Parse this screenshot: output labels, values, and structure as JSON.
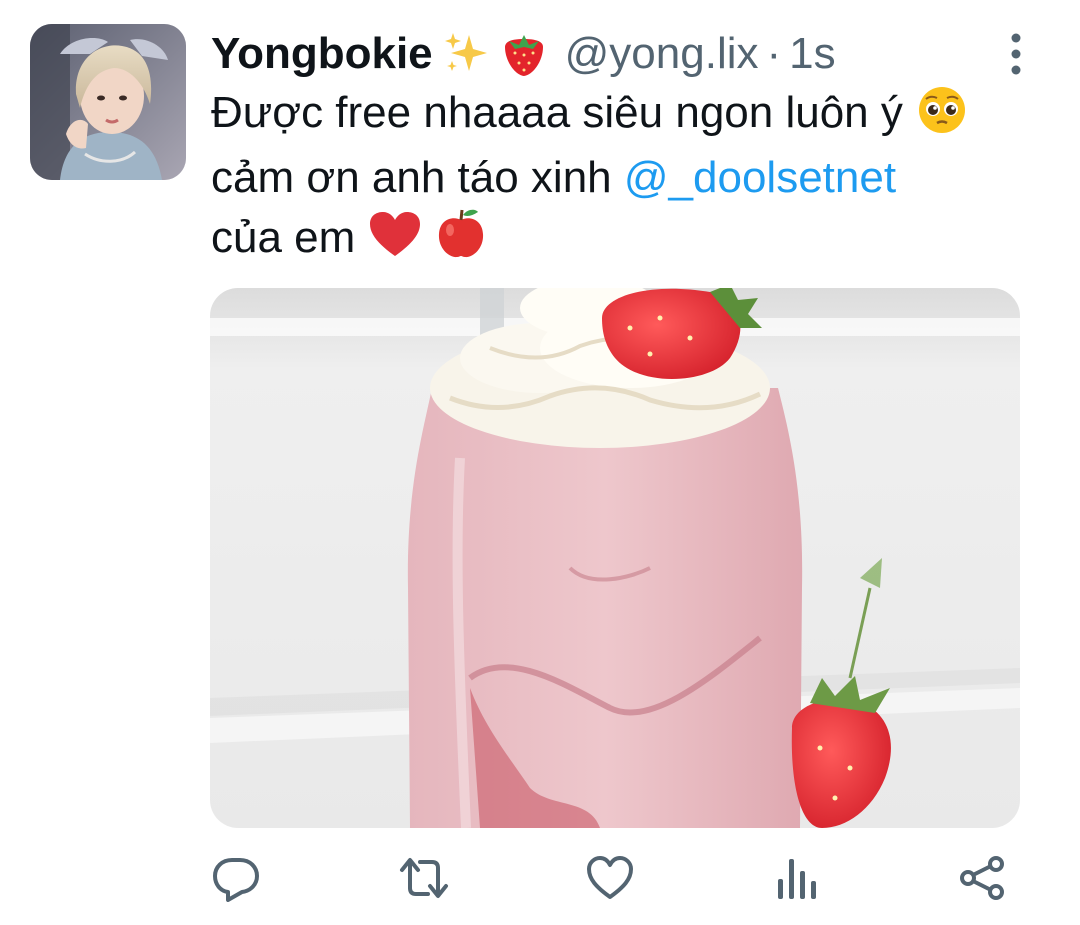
{
  "tweet": {
    "display_name": "Yongbokie",
    "name_emojis": [
      "sparkles",
      "strawberry"
    ],
    "handle": "@yong.lix",
    "separator": "·",
    "time": "1s",
    "text_line1": "Được free nhaaaa siêu ngon luôn ý",
    "text_line2_prefix": "cảm ơn anh táo xinh",
    "mention": "@_doolsetnet",
    "text_line3": "của em",
    "text_emojis": [
      "pleading-face",
      "red-heart",
      "red-apple"
    ]
  },
  "colors": {
    "text": "#0f1419",
    "secondary": "#536471",
    "link": "#1d9bf0",
    "icon": "#536471"
  },
  "actions": [
    {
      "name": "reply",
      "icon": "reply-icon"
    },
    {
      "name": "retweet",
      "icon": "retweet-icon"
    },
    {
      "name": "like",
      "icon": "heart-icon"
    },
    {
      "name": "views",
      "icon": "analytics-icon"
    },
    {
      "name": "share",
      "icon": "share-icon"
    }
  ]
}
